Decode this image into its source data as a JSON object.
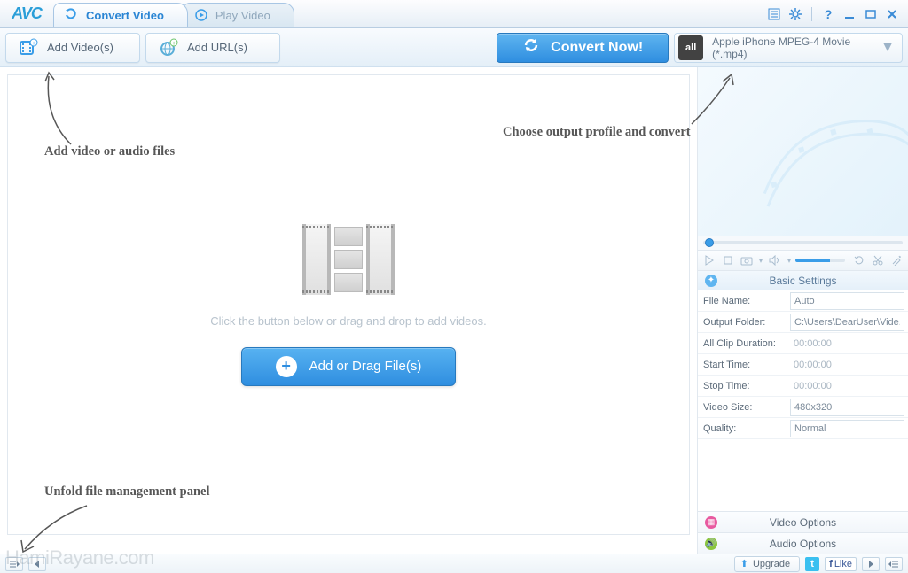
{
  "app": {
    "logo": "AVC"
  },
  "tabs": {
    "convert": "Convert Video",
    "play": "Play Video"
  },
  "toolbar": {
    "add_videos": "Add Video(s)",
    "add_urls": "Add URL(s)",
    "convert_now": "Convert Now!",
    "profile_label": "Apple iPhone MPEG-4 Movie (*.mp4)",
    "profile_icon_text": "all"
  },
  "canvas": {
    "hint": "Click the button below or drag and drop to add videos.",
    "add_button": "Add or Drag File(s)"
  },
  "annotations": {
    "add_files": "Add video or audio files",
    "choose_output": "Choose output profile and convert",
    "unfold_panel": "Unfold file management panel"
  },
  "basic": {
    "header": "Basic Settings",
    "rows": {
      "file_name": {
        "k": "File Name:",
        "v": "Auto",
        "type": "input"
      },
      "output_folder": {
        "k": "Output Folder:",
        "v": "C:\\Users\\DearUser\\Vide...",
        "type": "input"
      },
      "all_clip": {
        "k": "All Clip Duration:",
        "v": "00:00:00",
        "type": "readonly"
      },
      "start_time": {
        "k": "Start Time:",
        "v": "00:00:00",
        "type": "readonly"
      },
      "stop_time": {
        "k": "Stop Time:",
        "v": "00:00:00",
        "type": "readonly"
      },
      "video_size": {
        "k": "Video Size:",
        "v": "480x320",
        "type": "select"
      },
      "quality": {
        "k": "Quality:",
        "v": "Normal",
        "type": "select"
      }
    }
  },
  "options": {
    "video": "Video Options",
    "audio": "Audio Options"
  },
  "status": {
    "upgrade": "Upgrade",
    "like": "Like"
  },
  "watermark": "HamiRayane.com"
}
